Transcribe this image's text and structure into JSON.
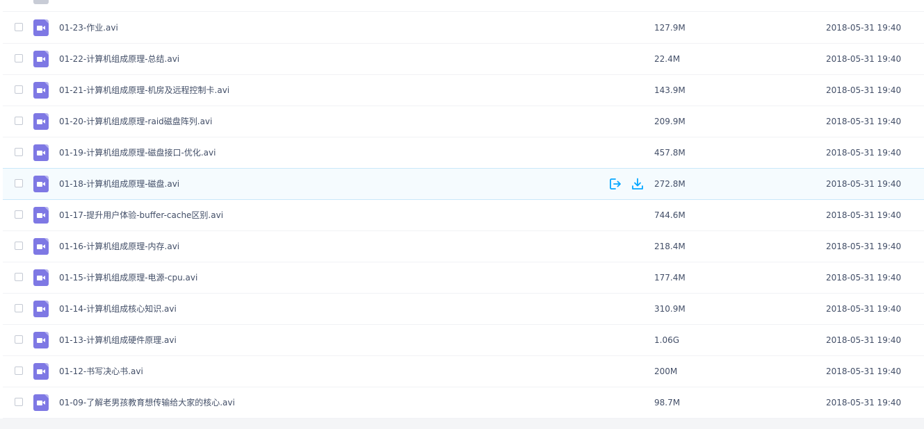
{
  "files": [
    {
      "name": "01-23-作业.avi",
      "size": "127.9M",
      "modified": "2018-05-31 19:40"
    },
    {
      "name": "01-22-计算机组成原理-总结.avi",
      "size": "22.4M",
      "modified": "2018-05-31 19:40"
    },
    {
      "name": "01-21-计算机组成原理-机房及远程控制卡.avi",
      "size": "143.9M",
      "modified": "2018-05-31 19:40"
    },
    {
      "name": "01-20-计算机组成原理-raid磁盘阵列.avi",
      "size": "209.9M",
      "modified": "2018-05-31 19:40"
    },
    {
      "name": "01-19-计算机组成原理-磁盘接口-优化.avi",
      "size": "457.8M",
      "modified": "2018-05-31 19:40"
    },
    {
      "name": "01-18-计算机组成原理-磁盘.avi",
      "size": "272.8M",
      "modified": "2018-05-31 19:40"
    },
    {
      "name": "01-17-提升用户体验-buffer-cache区别.avi",
      "size": "744.6M",
      "modified": "2018-05-31 19:40"
    },
    {
      "name": "01-16-计算机组成原理-内存.avi",
      "size": "218.4M",
      "modified": "2018-05-31 19:40"
    },
    {
      "name": "01-15-计算机组成原理-电源-cpu.avi",
      "size": "177.4M",
      "modified": "2018-05-31 19:40"
    },
    {
      "name": "01-14-计算机组成核心知识.avi",
      "size": "310.9M",
      "modified": "2018-05-31 19:40"
    },
    {
      "name": "01-13-计算机组成硬件原理.avi",
      "size": "1.06G",
      "modified": "2018-05-31 19:40"
    },
    {
      "name": "01-12-书写决心书.avi",
      "size": "200M",
      "modified": "2018-05-31 19:40"
    },
    {
      "name": "01-09-了解老男孩教育想传输给大家的核心.avi",
      "size": "98.7M",
      "modified": "2018-05-31 19:40"
    }
  ],
  "file_icon": "video-file-icon",
  "row_actions": {
    "share_icon": "share-icon",
    "download_icon": "download-icon"
  },
  "colors": {
    "video_icon": "#7e78e4",
    "action_icon": "#06a7ff",
    "hover_row": "#f5fbfe",
    "text": "#424e67"
  }
}
